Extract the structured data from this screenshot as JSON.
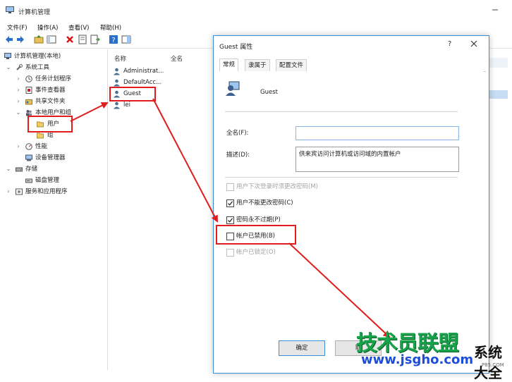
{
  "app": {
    "title": "计算机管理"
  },
  "menu": [
    "文件(F)",
    "操作(A)",
    "查看(V)",
    "帮助(H)"
  ],
  "tree": {
    "root": "计算机管理(本地)",
    "system_tools": "系统工具",
    "task_scheduler": "任务计划程序",
    "event_viewer": "事件查看器",
    "shared_folders": "共享文件夹",
    "local_users_groups": "本地用户和组",
    "users": "用户",
    "groups": "组",
    "performance": "性能",
    "device_manager": "设备管理器",
    "storage": "存储",
    "disk_management": "磁盘管理",
    "services_apps": "服务和应用程序"
  },
  "list": {
    "col_name": "名称",
    "col_fullname": "全名",
    "users": [
      "Administrat...",
      "DefaultAcc...",
      "Guest",
      "lei"
    ]
  },
  "dialog": {
    "title": "Guest 属性",
    "help": "?",
    "tabs": [
      "常规",
      "隶属于",
      "配置文件"
    ],
    "username": "Guest",
    "fullname_label": "全名(F):",
    "fullname_value": "",
    "desc_label": "描述(D):",
    "desc_value": "供来宾访问计算机或访问域的内置帐户",
    "checkboxes": [
      {
        "label": "用户下次登录时须更改密码(M)",
        "checked": false,
        "disabled": true
      },
      {
        "label": "用户不能更改密码(C)",
        "checked": true,
        "disabled": false
      },
      {
        "label": "密码永不过期(P)",
        "checked": true,
        "disabled": false
      },
      {
        "label": "帐户已禁用(B)",
        "checked": false,
        "disabled": false
      },
      {
        "label": "帐户已锁定(O)",
        "checked": false,
        "disabled": true
      }
    ],
    "ok": "确定",
    "cancel": "取"
  },
  "watermark": {
    "main": "技术员联盟",
    "side": "系统大全",
    "url": "www.jsgho.com",
    "suffix": "P85.COM"
  },
  "colors": {
    "annotation_red": "#e01c1c",
    "accent_blue": "#3a8fd8",
    "watermark_green": "#16a34a"
  }
}
